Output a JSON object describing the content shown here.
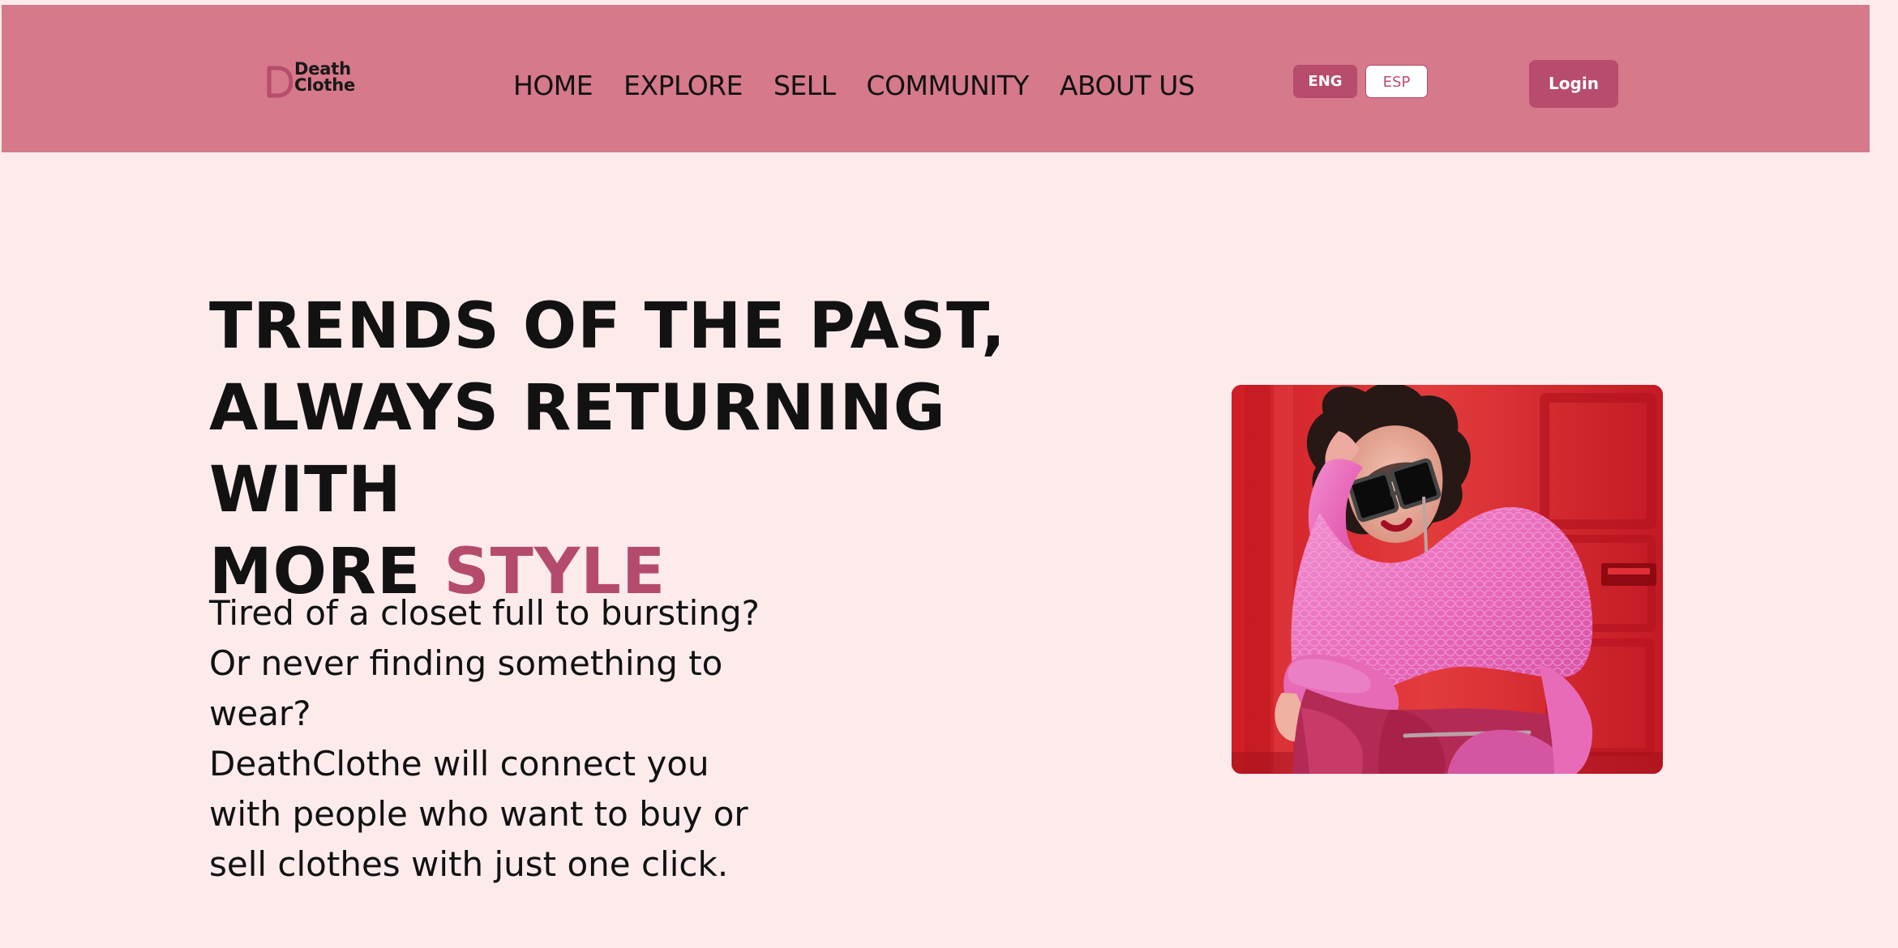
{
  "header": {
    "brand": {
      "line1": "Death",
      "line2": "Clothe"
    },
    "nav": [
      {
        "label": "HOME"
      },
      {
        "label": "EXPLORE"
      },
      {
        "label": "SELL"
      },
      {
        "label": "COMMUNITY"
      },
      {
        "label": "ABOUT US"
      }
    ],
    "languages": {
      "eng": "ENG",
      "esp": "ESP"
    },
    "login_label": "Login"
  },
  "hero": {
    "title_line1": "TRENDS OF THE PAST,",
    "title_line2": "ALWAYS RETURNING WITH",
    "title_line3_prefix": "MORE ",
    "title_line3_accent": "STYLE",
    "copy_lines": [
      "Tired of a closet full to bursting?",
      "Or never finding something to",
      "wear?",
      "DeathClothe will connect you",
      "with people who want to buy or",
      "sell clothes with just one click."
    ]
  },
  "colors": {
    "page_background": "#fdebec",
    "header_background": "#d5798b",
    "accent": "#b54b6c",
    "button_background": "#b74c6d"
  },
  "icons": {
    "logo_mark": "brand-d-logo-icon"
  }
}
